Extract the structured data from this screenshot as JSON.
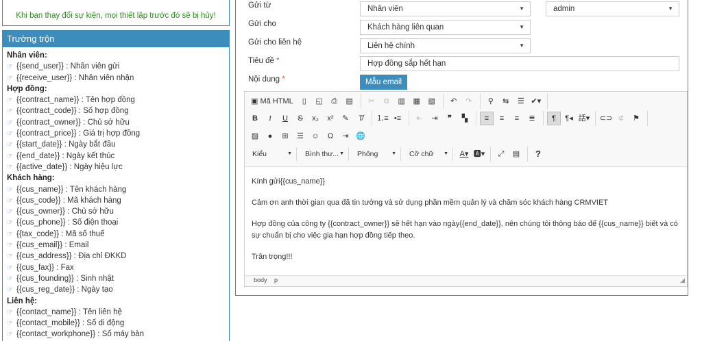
{
  "warning": "Khi bạn thay đổi sự kiện, mọi thiết lập trước đó sẽ bị hủy!",
  "merge_fields": {
    "title": "Trường trộn",
    "groups": [
      {
        "name": "Nhân viên:",
        "items": [
          {
            "code": "{{send_user}}",
            "desc": " : Nhân viên gửi"
          },
          {
            "code": "{{receive_user}}",
            "desc": " : Nhân viên nhận"
          }
        ]
      },
      {
        "name": "Hợp đồng:",
        "items": [
          {
            "code": "{{contract_name}}",
            "desc": " : Tên hợp đồng"
          },
          {
            "code": "{{contract_code}}",
            "desc": " : Số hợp đồng"
          },
          {
            "code": "{{contract_owner}}",
            "desc": " : Chủ sở hữu"
          },
          {
            "code": "{{contract_price}}",
            "desc": " : Giá trị hợp đồng"
          },
          {
            "code": "{{start_date}}",
            "desc": " : Ngày bắt đầu"
          },
          {
            "code": "{{end_date}}",
            "desc": " : Ngày kết thúc"
          },
          {
            "code": "{{active_date}}",
            "desc": " : Ngày hiệu lực"
          }
        ]
      },
      {
        "name": "Khách hàng:",
        "items": [
          {
            "code": "{{cus_name}}",
            "desc": " : Tên khách hàng"
          },
          {
            "code": "{{cus_code}}",
            "desc": " : Mã khách hàng"
          },
          {
            "code": "{{cus_owner}}",
            "desc": " : Chủ sở hữu"
          },
          {
            "code": "{{cus_phone}}",
            "desc": " : Số điện thoại"
          },
          {
            "code": "{{tax_code}}",
            "desc": " : Mã số thuế"
          },
          {
            "code": "{{cus_email}}",
            "desc": " : Email"
          },
          {
            "code": "{{cus_address}}",
            "desc": " : Địa chỉ ĐKKD"
          },
          {
            "code": "{{cus_fax}}",
            "desc": " : Fax"
          },
          {
            "code": "{{cus_founding}}",
            "desc": " : Sinh nhật"
          },
          {
            "code": "{{cus_reg_date}}",
            "desc": " : Ngày tạo"
          }
        ]
      },
      {
        "name": "Liên hệ:",
        "items": [
          {
            "code": "{{contact_name}}",
            "desc": " : Tên liên hệ"
          },
          {
            "code": "{{contact_mobile}}",
            "desc": " : Số di động"
          },
          {
            "code": "{{contact_workphone}}",
            "desc": " : Số máy bàn"
          }
        ]
      }
    ]
  },
  "form": {
    "send_from_label": "Gửi từ",
    "send_from_value": "Nhân viên",
    "send_from_user": "admin",
    "send_to_label": "Gửi cho",
    "send_to_value": "Khách hàng liên quan",
    "send_contact_label": "Gửi cho liên hệ",
    "send_contact_value": "Liên hệ chính",
    "subject_label": "Tiêu đề",
    "subject_value": "Hợp đồng sắp hết hạn",
    "content_label": "Nội dung",
    "required_mark": "*",
    "template_button": "Mẫu email"
  },
  "editor": {
    "source_label": "Mã HTML",
    "combo_style": "Kiểu",
    "combo_format": "Bình thư...",
    "combo_font": "Phông",
    "combo_size": "Cỡ chữ",
    "help_label": "?",
    "content": [
      "Kính gửi{{cus_name}}",
      "Cảm ơn anh thời gian qua đã tin tưởng và sử dụng phần mềm quản lý và chăm sóc khách hàng CRMVIET",
      "Hợp đồng của công ty {{contract_owner}} sẽ hết hạn vào ngày{{end_date}}, nên chúng tôi thông báo để {{cus_name}} biết và có sự chuẩn bị cho việc gia hạn hợp đồng tiếp theo.",
      "Trân trọng!!!"
    ],
    "path": [
      "body",
      "p"
    ]
  }
}
